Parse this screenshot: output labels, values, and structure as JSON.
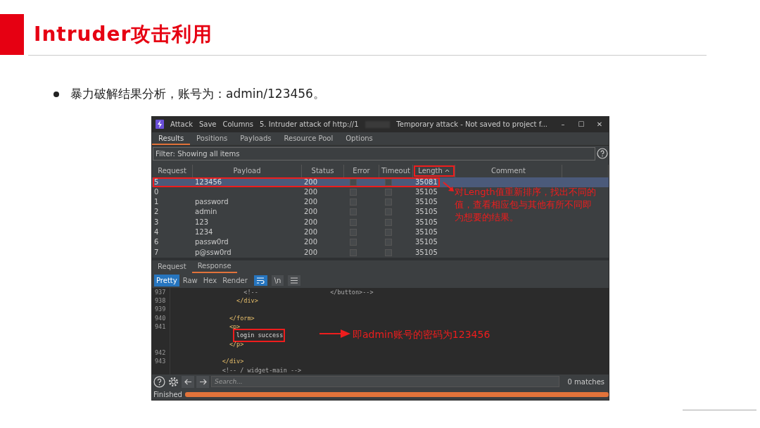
{
  "slide": {
    "title": "Intruder攻击利用",
    "bullet": "暴力破解结果分析，账号为：admin/123456。"
  },
  "window": {
    "menu": [
      "Attack",
      "Save",
      "Columns"
    ],
    "title": "5. Intruder attack of http://1",
    "status": "Temporary attack - Not saved to project f...",
    "controls": [
      "–",
      "☐",
      "✕"
    ]
  },
  "tabs": [
    {
      "label": "Results",
      "selected": true
    },
    {
      "label": "Positions",
      "selected": false
    },
    {
      "label": "Payloads",
      "selected": false
    },
    {
      "label": "Resource Pool",
      "selected": false
    },
    {
      "label": "Options",
      "selected": false
    }
  ],
  "filter": "Filter: Showing all items",
  "table": {
    "columns": [
      {
        "label": "Request",
        "highlighted": false,
        "sorted": false
      },
      {
        "label": "Payload",
        "highlighted": false,
        "sorted": false
      },
      {
        "label": "Status",
        "highlighted": false,
        "sorted": false
      },
      {
        "label": "Error",
        "highlighted": false,
        "sorted": false
      },
      {
        "label": "Timeout",
        "highlighted": false,
        "sorted": false
      },
      {
        "label": "Length",
        "highlighted": true,
        "sorted": true
      },
      {
        "label": "Comment",
        "highlighted": false,
        "sorted": false
      }
    ],
    "rows": [
      {
        "request": "5",
        "payload": "123456",
        "status": "200",
        "error": false,
        "timeout": false,
        "length": "35081",
        "selected": true,
        "highlighted": true
      },
      {
        "request": "0",
        "status": "200",
        "error": false,
        "timeout": false,
        "length": "35105",
        "selected": false,
        "highlighted": false
      },
      {
        "request": "1",
        "payload": "password",
        "status": "200",
        "error": false,
        "timeout": false,
        "length": "35105",
        "selected": false,
        "highlighted": false
      },
      {
        "request": "2",
        "payload": "admin",
        "status": "200",
        "error": false,
        "timeout": false,
        "length": "35105",
        "selected": false,
        "highlighted": false
      },
      {
        "request": "3",
        "payload": "123",
        "status": "200",
        "error": false,
        "timeout": false,
        "length": "35105",
        "selected": false,
        "highlighted": false
      },
      {
        "request": "4",
        "payload": "1234",
        "status": "200",
        "error": false,
        "timeout": false,
        "length": "35105",
        "selected": false,
        "highlighted": false
      },
      {
        "request": "6",
        "payload": "passw0rd",
        "status": "200",
        "error": false,
        "timeout": false,
        "length": "35105",
        "selected": false,
        "highlighted": false
      },
      {
        "request": "7",
        "payload": "p@ssw0rd",
        "status": "200",
        "error": false,
        "timeout": false,
        "length": "35105",
        "selected": false,
        "highlighted": false
      }
    ]
  },
  "sort_note": "对Length值重新排序，找出不同的值，查看相应包与其他有所不同即为想要的结果。",
  "message_tabs": [
    {
      "label": "Request",
      "selected": false
    },
    {
      "label": "Response",
      "selected": true
    }
  ],
  "view_modes": [
    {
      "label": "Pretty",
      "selected": true
    },
    {
      "label": "Raw",
      "selected": false
    },
    {
      "label": "Hex",
      "selected": false
    },
    {
      "label": "Render",
      "selected": false
    }
  ],
  "view_toggles": [
    {
      "kind": "wrap",
      "selected": true
    },
    {
      "kind": "newline",
      "label": "\\n",
      "selected": false
    },
    {
      "kind": "menu",
      "selected": false
    }
  ],
  "code": [
    {
      "number": "937",
      "text": "                    <!--                    </button>-->",
      "kind": "comment",
      "highlighted": false
    },
    {
      "number": "938",
      "text": "                  </div>",
      "kind": "tag",
      "highlighted": false
    },
    {
      "number": "939",
      "kind": "text"
    },
    {
      "number": "940",
      "text": "                </form>",
      "kind": "tag",
      "highlighted": false
    },
    {
      "number": "941",
      "text": "                <p>",
      "kind": "tag",
      "highlighted": false
    },
    {
      "text": "                  login success",
      "kind": "text",
      "highlighted": true
    },
    {
      "text": "                </p>",
      "kind": "tag",
      "highlighted": false
    },
    {
      "number": "942",
      "kind": "text"
    },
    {
      "number": "943",
      "text": "              </div>",
      "kind": "tag",
      "highlighted": false
    },
    {
      "text": "              <!-- / widget-main -->",
      "kind": "comment",
      "highlighted": false
    }
  ],
  "response_note": "即admin账号的密码为123456",
  "search": {
    "placeholder": "Search...",
    "matches": "0 matches"
  },
  "status_bar": {
    "text": "Finished",
    "level": 1
  }
}
